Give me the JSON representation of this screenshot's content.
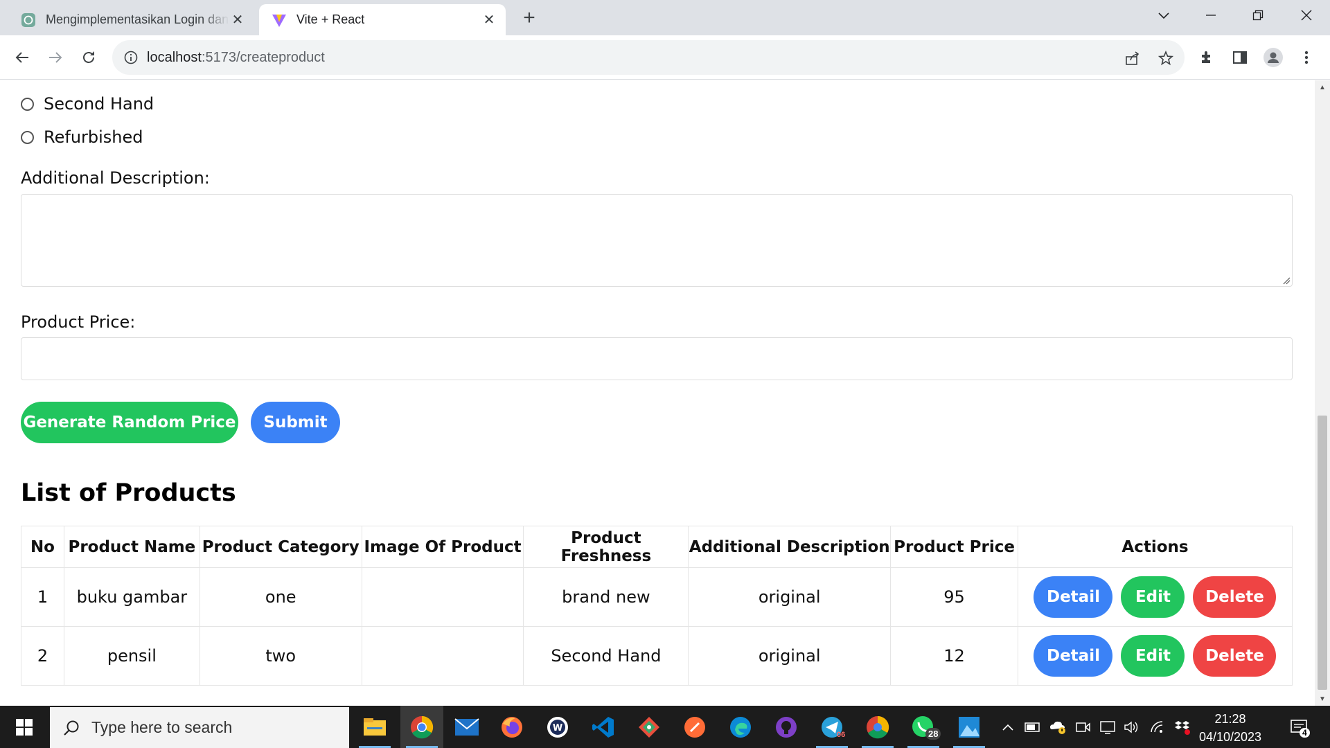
{
  "browser": {
    "tabs": [
      {
        "title": "Mengimplementasikan Login dan",
        "active": false,
        "icon": "chatgpt-icon"
      },
      {
        "title": "Vite + React",
        "active": true,
        "icon": "vite-icon"
      }
    ],
    "address": {
      "host": "localhost",
      "path": ":5173/createproduct"
    }
  },
  "form": {
    "freshness_options": [
      "Second Hand",
      "Refurbished"
    ],
    "description_label": "Additional Description:",
    "price_label": "Product Price:",
    "generate_button": "Generate Random Price",
    "submit_button": "Submit"
  },
  "products": {
    "heading": "List of Products",
    "columns": [
      "No",
      "Product Name",
      "Product Category",
      "Image Of Product",
      "Product Freshness",
      "Additional Description",
      "Product Price",
      "Actions"
    ],
    "rows": [
      {
        "no": "1",
        "name": "buku gambar",
        "category": "one",
        "image": "",
        "freshness": "brand new",
        "description": "original",
        "price": "95"
      },
      {
        "no": "2",
        "name": "pensil",
        "category": "two",
        "image": "",
        "freshness": "Second Hand",
        "description": "original",
        "price": "12"
      }
    ],
    "actions": {
      "detail": "Detail",
      "edit": "Edit",
      "delete": "Delete"
    }
  },
  "taskbar": {
    "search_placeholder": "Type here to search",
    "time": "21:28",
    "date": "04/10/2023",
    "telegram_badge": "06",
    "whatsapp_badge": "28",
    "notification_count": "4"
  },
  "colors": {
    "green": "#22c55e",
    "blue": "#3b82f6",
    "red": "#ef4444"
  }
}
